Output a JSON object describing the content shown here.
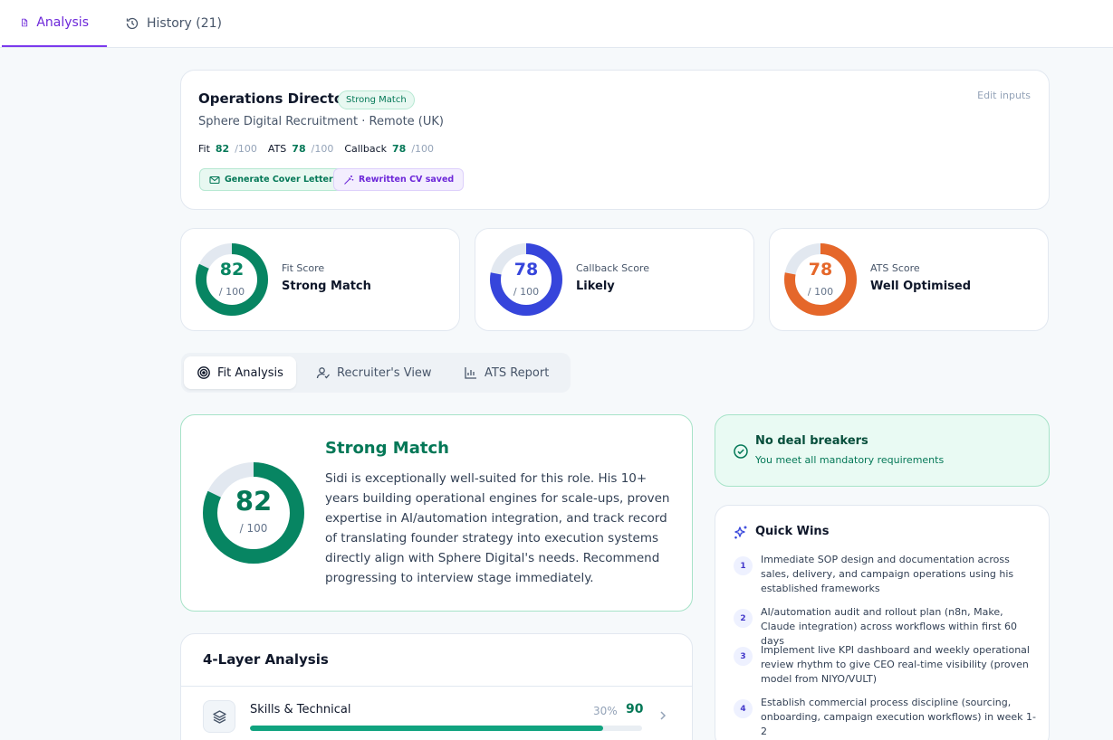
{
  "tabs": [
    {
      "label": "Analysis",
      "icon": "document-icon",
      "active": true
    },
    {
      "label": "History (21)",
      "icon": "history-icon",
      "active": false
    }
  ],
  "job": {
    "title": "Operations Director",
    "badge": "Strong Match",
    "company": "Sphere Digital Recruitment · Remote (UK)",
    "edit_label": "Edit inputs",
    "scores": [
      {
        "label": "Fit",
        "value": "82",
        "max": "/100"
      },
      {
        "label": "ATS",
        "value": "78",
        "max": "/100"
      },
      {
        "label": "Callback",
        "value": "78",
        "max": "/100"
      }
    ],
    "actions": {
      "cover_letter": "Generate Cover Letter",
      "cv_saved": "Rewritten CV saved"
    }
  },
  "score_cards": [
    {
      "value": "82",
      "max": "/ 100",
      "fraction": 0.82,
      "color": "#078562",
      "label": "Fit Score",
      "status": "Strong Match"
    },
    {
      "value": "78",
      "max": "/ 100",
      "fraction": 0.78,
      "color": "#3645db",
      "label": "Callback Score",
      "status": "Likely"
    },
    {
      "value": "78",
      "max": "/ 100",
      "fraction": 0.78,
      "color": "#e5672a",
      "label": "ATS Score",
      "status": "Well Optimised"
    }
  ],
  "analysis_tabs": [
    {
      "label": "Fit Analysis",
      "icon": "target-icon",
      "active": true
    },
    {
      "label": "Recruiter's View",
      "icon": "user-check-icon",
      "active": false
    },
    {
      "label": "ATS Report",
      "icon": "bar-chart-icon",
      "active": false
    }
  ],
  "summary": {
    "value": "82",
    "max": "/ 100",
    "fraction": 0.82,
    "title": "Strong Match",
    "description": "Sidi is exceptionally well-suited for this role. His 10+ years building operational engines for scale-ups, proven expertise in AI/automation integration, and track record of translating founder strategy into execution systems directly align with Sphere Digital's needs. Recommend progressing to interview stage immediately."
  },
  "deal_breakers": {
    "title": "No deal breakers",
    "subtitle": "You meet all mandatory requirements"
  },
  "quick_wins": {
    "title": "Quick Wins",
    "items": [
      {
        "num": "1",
        "text": "Immediate SOP design and documentation across sales, delivery, and campaign operations using his established frameworks"
      },
      {
        "num": "2",
        "text": "AI/automation audit and rollout plan (n8n, Make, Claude integration) across workflows within first 60 days"
      },
      {
        "num": "3",
        "text": "Implement live KPI dashboard and weekly operational review rhythm to give CEO real-time visibility (proven model from NIYO/VULT)"
      },
      {
        "num": "4",
        "text": "Establish commercial process discipline (sourcing, onboarding, campaign execution workflows) in week 1-2"
      }
    ]
  },
  "layers": {
    "title": "4-Layer Analysis",
    "items": [
      {
        "name": "Skills & Technical",
        "weight": "30%",
        "score": "90",
        "fraction": 0.9
      }
    ]
  }
}
